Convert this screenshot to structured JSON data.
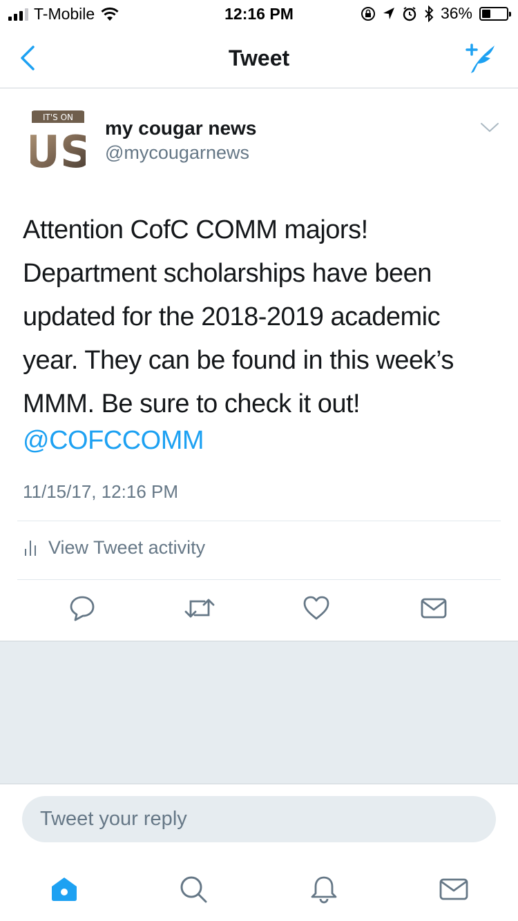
{
  "status_bar": {
    "carrier": "T-Mobile",
    "time": "12:16 PM",
    "battery_percent": "36%",
    "battery_level": 0.36,
    "signal_bars_active": 3,
    "signal_bars_total": 4
  },
  "nav": {
    "title": "Tweet",
    "back_icon": "chevron-left-icon",
    "compose_icon": "compose-tweet-icon"
  },
  "tweet": {
    "author_name": "my cougar news",
    "author_handle": "@mycougarnews",
    "avatar_text_top": "IT'S ON",
    "avatar_text_main": "US",
    "text_lines": [
      "Attention CofC COMM majors!",
      "Department scholarships have been",
      "updated for the 2018-2019 academic",
      "year. They can be found in this week’s",
      "MMM. Be sure to check it out!"
    ],
    "mention": "@COFCCOMM",
    "timestamp": "11/15/17, 12:16 PM",
    "activity_label": "View Tweet activity"
  },
  "actions": [
    "reply-icon",
    "retweet-icon",
    "like-icon",
    "direct-message-icon"
  ],
  "reply": {
    "placeholder": "Tweet your reply"
  },
  "tab_bar": [
    "home-icon",
    "search-icon",
    "notifications-icon",
    "messages-icon"
  ],
  "colors": {
    "accent": "#1da1f2",
    "secondary_text": "#657786",
    "primary_text": "#14171a",
    "background_gray": "#e6ecf0",
    "border": "#e1e8ed"
  }
}
